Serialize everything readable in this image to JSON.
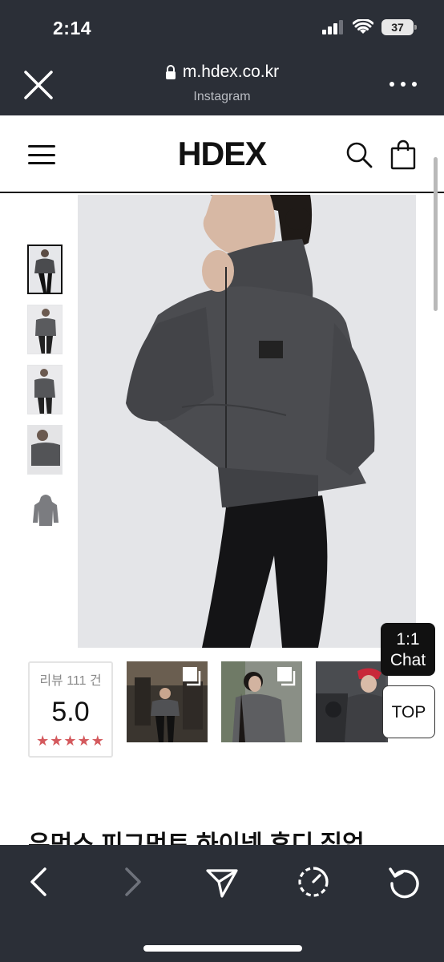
{
  "status": {
    "time": "2:14",
    "battery": "37"
  },
  "browser": {
    "url": "m.hdex.co.kr",
    "source": "Instagram"
  },
  "site": {
    "logo": "HDEX"
  },
  "reviews": {
    "label": "리뷰 111 건",
    "score": "5.0",
    "stars": "★★★★★"
  },
  "floating": {
    "chat_line1": "1:1",
    "chat_line2": "Chat",
    "top": "TOP"
  },
  "product": {
    "title": "우먼스 피그먼트 하이넥 후디 집업"
  },
  "icons": [
    "close-icon",
    "lock-icon",
    "more-icon",
    "hamburger-icon",
    "search-icon",
    "bag-icon",
    "back-icon",
    "forward-icon",
    "share-icon",
    "timer-icon",
    "refresh-icon"
  ],
  "colors": {
    "chrome": "#2b2f37",
    "star": "#d4595d",
    "hoodie": "#4a4b4e"
  }
}
